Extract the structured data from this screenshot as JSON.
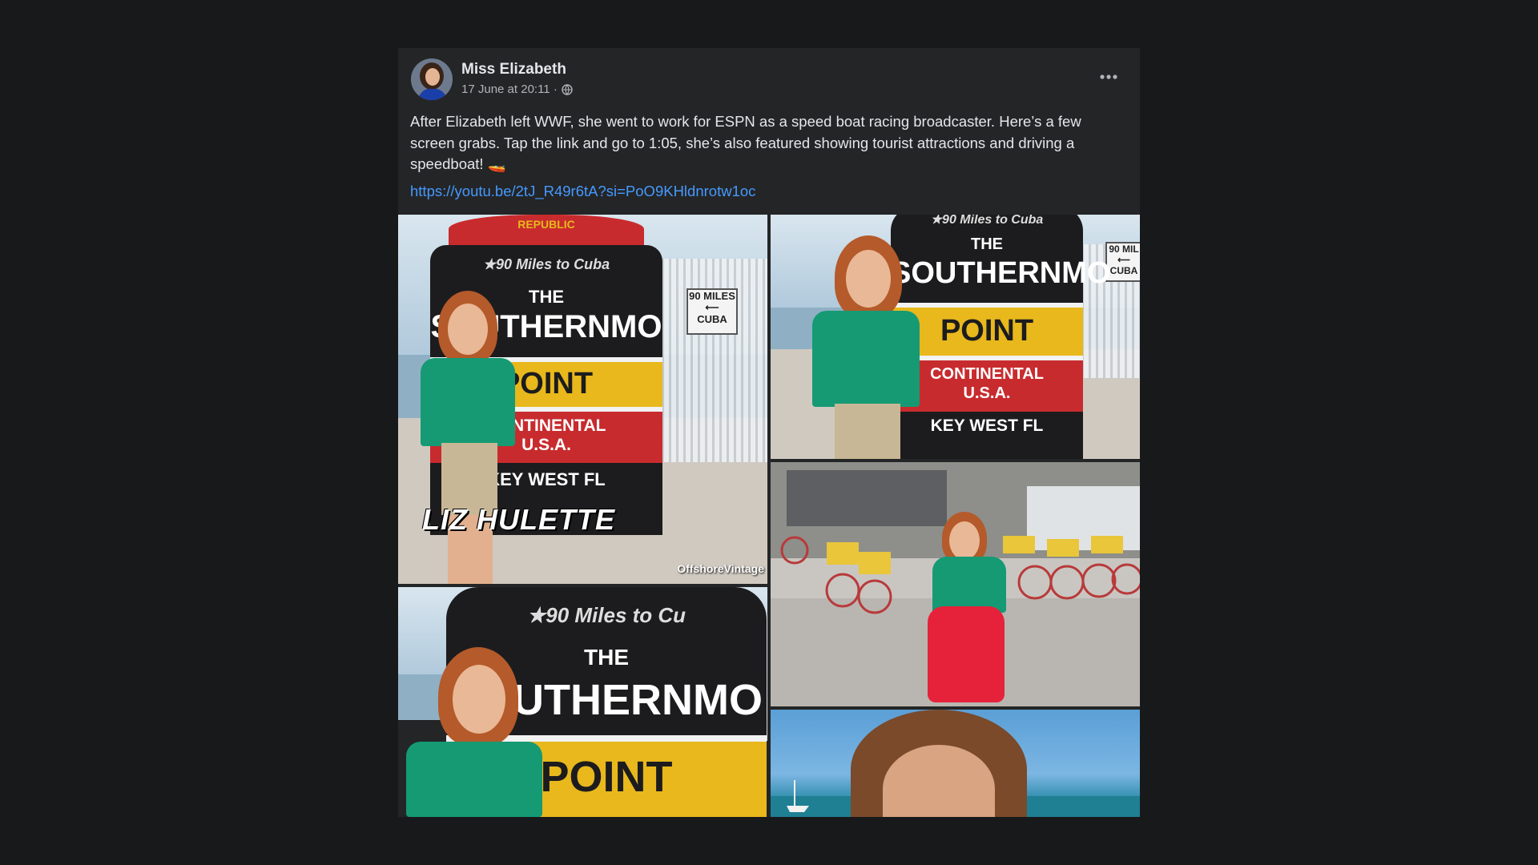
{
  "post": {
    "author": "Miss Elizabeth",
    "timestamp": "17 June at 20:11 ·",
    "privacy_icon": "globe-icon",
    "menu_icon": "more-horizontal-icon",
    "text": "After Elizabeth left WWF, she went to work for ESPN  as a speed boat racing broadcaster. Here’s a few screen grabs. Tap the link and go to 1:05, she’s also featured showing tourist attractions and driving a speedboat! 🚤",
    "link": "https://youtu.be/2tJ_R49r6tA?si=PoO9KHldnrotw1oc"
  },
  "photos": {
    "p1": {
      "buoy_top": "REPUBLIC",
      "buoy_stars": "★90 Miles to Cuba",
      "buoy_the": "THE",
      "buoy_main": "SOUTHERNMO",
      "buoy_point": "POINT",
      "buoy_continental": "CONTINENTAL",
      "buoy_usa": "U.S.A.",
      "buoy_keywest": "KEY WEST FL",
      "sign_line1": "90 MILES",
      "sign_line2": "CUBA",
      "caption": "LIZ HULETTE",
      "watermark": "OffshoreVintage"
    },
    "p2": {
      "buoy_stars": "★90 Miles to Cuba",
      "buoy_the": "THE",
      "buoy_main": "SOUTHERNMO",
      "buoy_point": "POINT",
      "buoy_continental": "CONTINENTAL",
      "buoy_usa": "U.S.A.",
      "buoy_keywest": "KEY WEST FL",
      "sign_line1": "90 MIL",
      "sign_line2": "CUBA"
    },
    "p3": {
      "buoy_stars": "★90 Miles to Cu",
      "buoy_the": "THE",
      "buoy_main": "SOUTHERNMO",
      "buoy_point": "POINT"
    }
  },
  "colors": {
    "background": "#18191a",
    "card": "#242526",
    "text_primary": "#e4e6eb",
    "text_secondary": "#b0b3b8",
    "link": "#4599ff"
  }
}
